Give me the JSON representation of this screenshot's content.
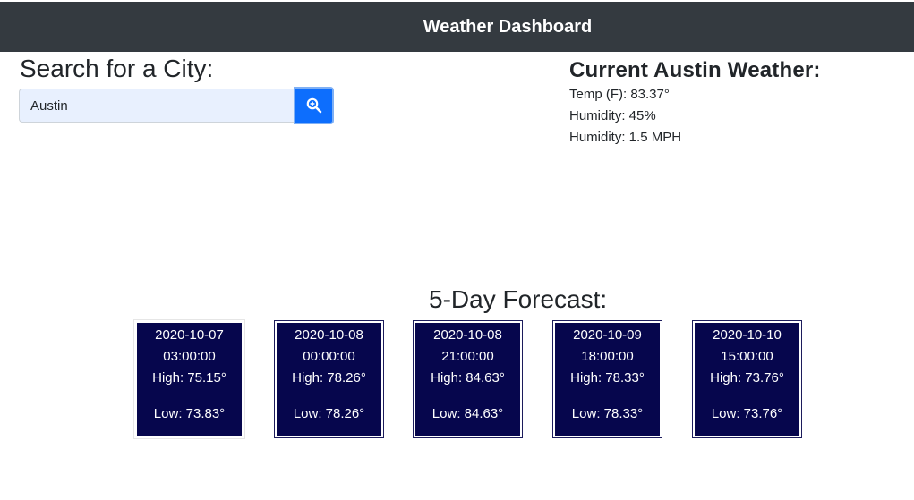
{
  "navbar": {
    "title": "Weather Dashboard"
  },
  "search": {
    "heading": "Search for a City:",
    "value": "Austin",
    "button_icon": "zoom-in-magnifier-icon"
  },
  "current": {
    "heading": "Current Austin Weather:",
    "lines": [
      "Temp (F): 83.37°",
      "Humidity: 45%",
      "Humidity: 1.5 MPH"
    ]
  },
  "forecast": {
    "heading": "5-Day Forecast:",
    "days": [
      {
        "date": "2020-10-07",
        "time": "03:00:00",
        "high": "High: 75.15°",
        "low": "Low: 73.83°"
      },
      {
        "date": "2020-10-08",
        "time": "00:00:00",
        "high": "High: 78.26°",
        "low": "Low: 78.26°"
      },
      {
        "date": "2020-10-08",
        "time": "21:00:00",
        "high": "High: 84.63°",
        "low": "Low: 84.63°"
      },
      {
        "date": "2020-10-09",
        "time": "18:00:00",
        "high": "High: 78.33°",
        "low": "Low: 78.33°"
      },
      {
        "date": "2020-10-10",
        "time": "15:00:00",
        "high": "High: 73.76°",
        "low": "Low: 73.76°"
      }
    ]
  },
  "colors": {
    "navbar_bg": "#343a40",
    "button_bg": "#0d6efd",
    "card_bg": "#06064d",
    "input_bg": "#e8f0fe"
  }
}
